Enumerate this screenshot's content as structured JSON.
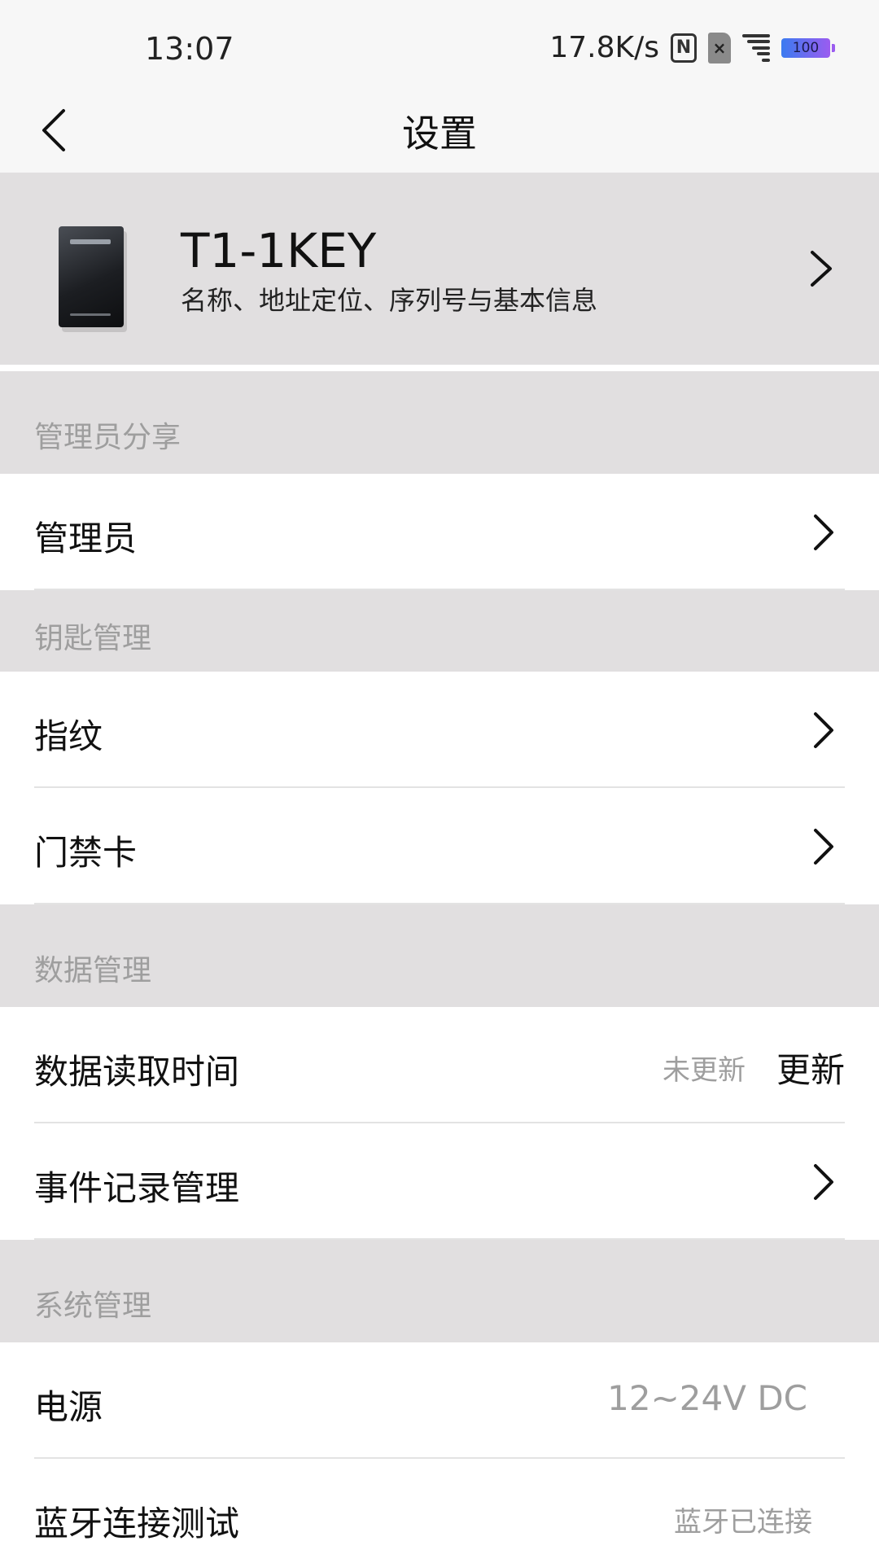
{
  "status_bar": {
    "time": "13:07",
    "speed": "17.8K/s",
    "sim_label": "×",
    "battery": "100",
    "nfc_label": "N"
  },
  "nav": {
    "title": "设置",
    "back_icon": "chevron-left-icon"
  },
  "device": {
    "name": "T1-1KEY",
    "subtitle": "名称、地址定位、序列号与基本信息"
  },
  "sections": {
    "admin_share": {
      "header": "管理员分享",
      "rows": {
        "admin": "管理员"
      }
    },
    "key_manage": {
      "header": "钥匙管理",
      "rows": {
        "fingerprint": "指纹",
        "access_card": "门禁卡"
      }
    },
    "data_manage": {
      "header": "数据管理",
      "rows": {
        "read_time": {
          "label": "数据读取时间",
          "value": "未更新",
          "action": "更新"
        },
        "event_log": "事件记录管理"
      }
    },
    "system_manage": {
      "header": "系统管理",
      "rows": {
        "power": {
          "label": "电源",
          "value": "12~24V DC"
        },
        "bluetooth": {
          "label": "蓝牙连接测试",
          "value": "蓝牙已连接"
        }
      }
    }
  },
  "colors": {
    "section_bg": "#e1dfe0",
    "header_bg": "#f7f7f7",
    "muted_text": "#9e9e9e"
  }
}
